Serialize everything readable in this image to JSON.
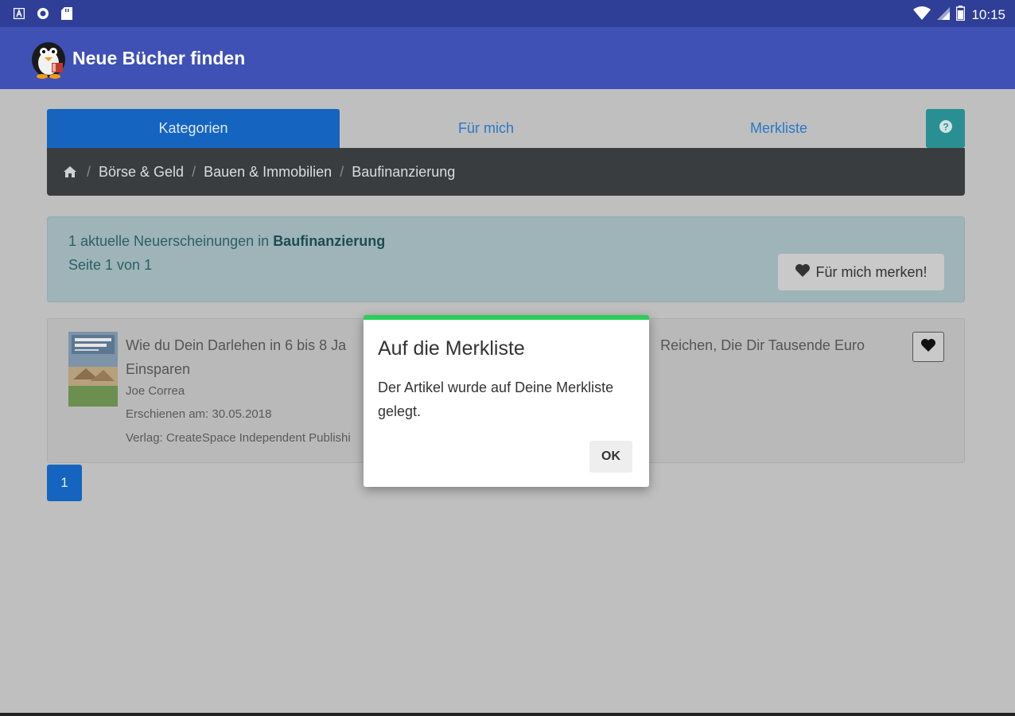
{
  "status_bar": {
    "time": "10:15",
    "left_icons": [
      "notification-a-icon",
      "sync-icon",
      "sd-card-icon"
    ],
    "right_icons": [
      "wifi-icon",
      "signal-icon",
      "battery-icon"
    ]
  },
  "app_bar": {
    "title": "Neue Bücher finden",
    "logo_icon": "penguin-logo-icon",
    "color": "#3f51b5"
  },
  "tabs": [
    {
      "label": "Kategorien",
      "active": true
    },
    {
      "label": "Für mich",
      "active": false
    },
    {
      "label": "Merkliste",
      "active": false
    }
  ],
  "help_icon": "question-circle-icon",
  "breadcrumb": {
    "home_icon": "home-icon",
    "items": [
      "Börse & Geld",
      "Bauen & Immobilien",
      "Baufinanzierung"
    ]
  },
  "info": {
    "count_text": "1 aktuelle Neuerscheinungen in ",
    "category": "Baufinanzierung",
    "page_text": "Seite 1 von 1",
    "merk_button": "Für mich merken!"
  },
  "book": {
    "title_start": "Wie du Dein Darlehen in 6 bis 8 Ja",
    "title_end": "Reichen, Die Dir Tausende Euro",
    "title_line2": "Einsparen",
    "author": "Joe Correa",
    "published": "Erschienen am: 30.05.2018",
    "publisher": "Verlag: CreateSpace Independent Publishi"
  },
  "pagination": {
    "current": "1"
  },
  "dialog": {
    "title": "Auf die Merkliste",
    "message": "Der Artikel wurde auf Deine Merkliste gelegt.",
    "ok_label": "OK",
    "accent": "#2ecc5a"
  }
}
